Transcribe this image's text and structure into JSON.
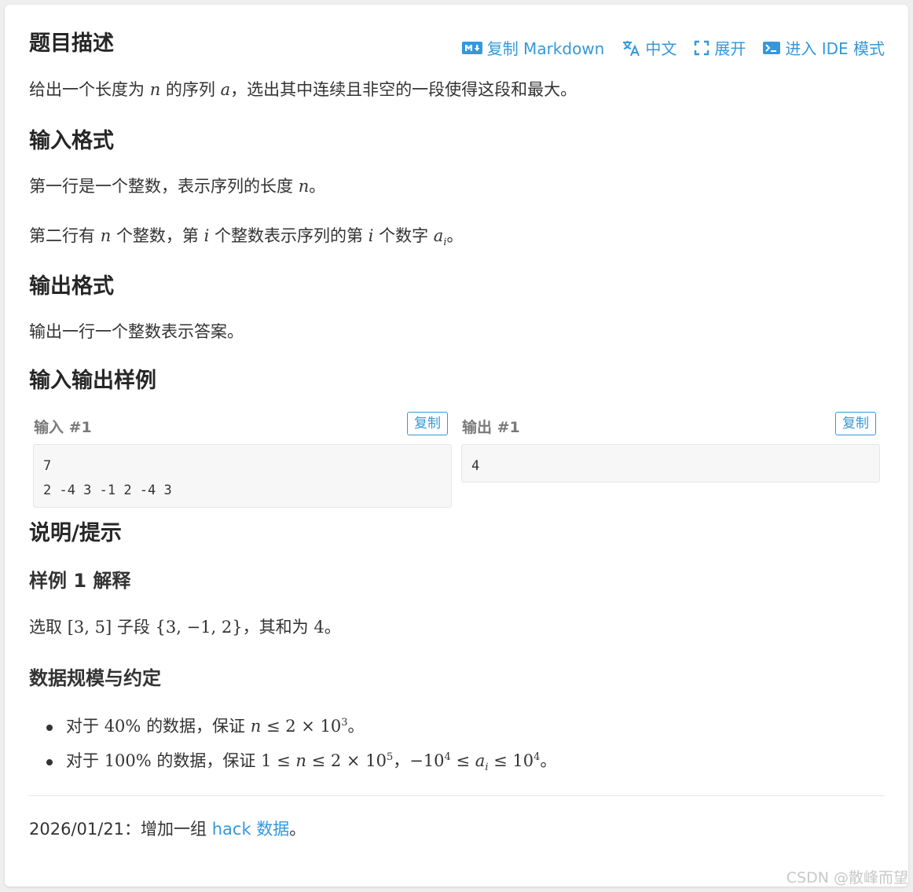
{
  "title": "题目描述",
  "toolbar": {
    "copy_markdown": "复制 Markdown",
    "language": "中文",
    "expand": "展开",
    "ide_mode": "进入 IDE 模式"
  },
  "description": {
    "p1": "给出一个长度为",
    "var_n": "n",
    "p2": "的序列",
    "var_a": "a",
    "p3": "，选出其中连续且非空的一段使得这段和最大。"
  },
  "input_format": {
    "heading": "输入格式",
    "line1_a": "第一行是一个整数，表示序列的长度",
    "line1_var": "n",
    "line1_b": "。",
    "line2_a": "第二行有",
    "line2_n": "n",
    "line2_b": "个整数，第",
    "line2_i": "i",
    "line2_c": "个整数表示序列的第",
    "line2_i2": "i",
    "line2_d": "个数字",
    "line2_ai": "a",
    "line2_sub": "i",
    "line2_e": "。"
  },
  "output_format": {
    "heading": "输出格式",
    "line1": "输出一行一个整数表示答案。"
  },
  "samples": {
    "heading": "输入输出样例",
    "input_label": "输入 #1",
    "output_label": "输出 #1",
    "copy_label": "复制",
    "input_value": "7\n2 -4 3 -1 2 -4 3",
    "output_value": "4"
  },
  "hint": {
    "heading": "说明/提示",
    "sub1": "样例 1 解释",
    "explain_a": "选取",
    "explain_range": "[3, 5]",
    "explain_b": "子段",
    "explain_set": "{3, −1, 2}",
    "explain_c": "，其和为",
    "explain_sum": "4",
    "explain_d": "。",
    "sub2": "数据规模与约定",
    "b1_a": "对于",
    "b1_pct": "40%",
    "b1_b": "的数据，保证",
    "b1_n": "n",
    "b1_expr": " ≤ 2 × 10",
    "b1_exp": "3",
    "b1_c": "。",
    "b2_a": "对于",
    "b2_pct": "100%",
    "b2_b": "的数据，保证",
    "b2_expr1": "1 ≤ ",
    "b2_n": "n",
    "b2_expr2": " ≤ 2 × 10",
    "b2_exp": "5",
    "b2_c": "，",
    "b2_expr3": "−10",
    "b2_exp2": "4",
    "b2_expr4": " ≤ ",
    "b2_a_var": "a",
    "b2_sub": "i",
    "b2_expr5": " ≤ 10",
    "b2_exp3": "4",
    "b2_d": "。"
  },
  "footer": {
    "date": "2026/01/21：增加一组",
    "link": "hack 数据",
    "end": "。"
  },
  "watermark": "CSDN @散峰而望",
  "colors": {
    "accent": "#3498db",
    "text": "#333333",
    "code_bg": "#f7f7f7"
  }
}
